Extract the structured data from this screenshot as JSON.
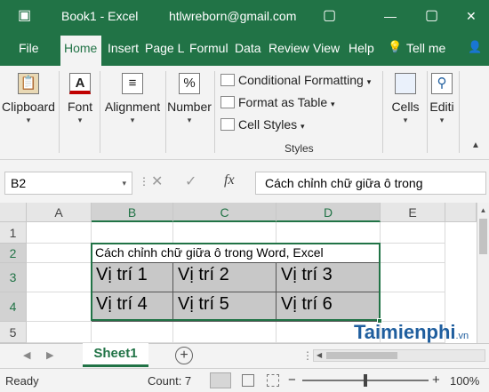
{
  "titlebar": {
    "save_icon": "save-icon",
    "title": "Book1 -  Excel",
    "account": "htlwreborn@gmail.com",
    "btn_min": "—",
    "btn_restore": "▢",
    "btn_close": "✕"
  },
  "tabs": [
    "File",
    "Home",
    "Insert",
    "Page L",
    "Formul",
    "Data",
    "Review",
    "View",
    "Help"
  ],
  "tell_me": "Tell me",
  "tell_me_icon": "💡",
  "share_icon": "👤",
  "ribbon": {
    "clipboard": "Clipboard",
    "font": "Font",
    "font_icon": "A",
    "alignment": "Alignment",
    "alignment_icon": "≡",
    "number": "Number",
    "number_icon": "%",
    "cond_format": "Conditional Formatting",
    "format_table": "Format as Table",
    "cell_styles": "Cell Styles",
    "styles_caption": "Styles",
    "cells": "Cells",
    "editing": "Editi",
    "dropdown": "▾"
  },
  "formula_bar": {
    "name_box": "B2",
    "cancel": "✕",
    "enter": "✓",
    "fx": "fx",
    "content": "Cách chỉnh chữ giữa ô trong"
  },
  "columns": [
    "A",
    "B",
    "C",
    "D",
    "E"
  ],
  "rows": [
    "1",
    "2",
    "3",
    "4",
    "5"
  ],
  "cells": {
    "B2": "Cách chỉnh chữ giữa ô trong Word, Excel",
    "B3": "Vị trí 1",
    "C3": "Vị trí 2",
    "D3": "Vị trí 3",
    "B4": "Vị trí 4",
    "C4": "Vị trí 5",
    "D4": "Vị trí 6"
  },
  "sheet": {
    "tab": "Sheet1",
    "add": "+"
  },
  "status": {
    "ready": "Ready",
    "count": "Count: 7",
    "zoom_minus": "−",
    "zoom_plus": "+",
    "zoom": "100%"
  },
  "watermark": {
    "text": "Taimienphi",
    "suffix": ".vn"
  },
  "colors": {
    "excel_green": "#217346",
    "selected_fill": "#c8c8c8"
  }
}
